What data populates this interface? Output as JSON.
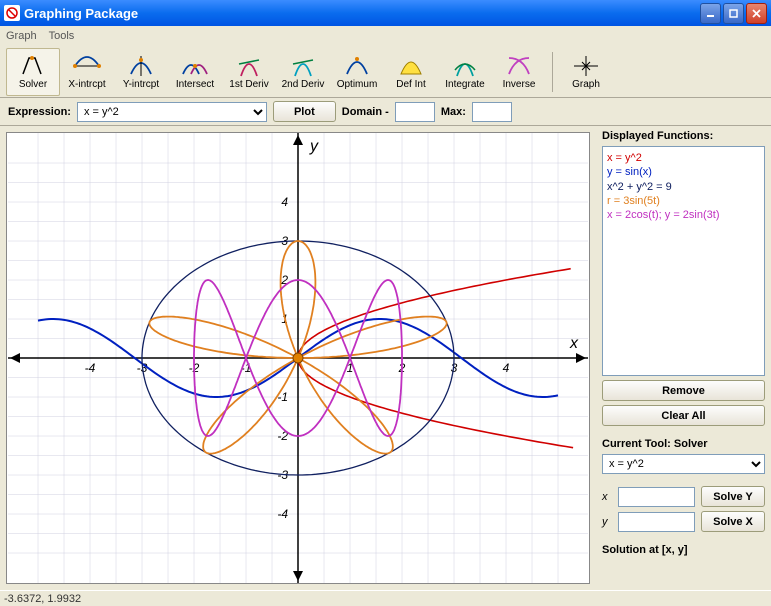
{
  "window": {
    "title": "Graphing Package"
  },
  "menu": {
    "graph": "Graph",
    "tools": "Tools"
  },
  "toolbar": {
    "solver": "Solver",
    "xintrcpt": "X-intrcpt",
    "yintrcpt": "Y-intrcpt",
    "intersect": "Intersect",
    "deriv1": "1st Deriv",
    "deriv2": "2nd Deriv",
    "optimum": "Optimum",
    "defint": "Def Int",
    "integrate": "Integrate",
    "inverse": "Inverse",
    "graph": "Graph"
  },
  "exprbar": {
    "label": "Expression:",
    "value": "x = y^2",
    "plot": "Plot",
    "domain_label": "Domain -",
    "domain_min": "",
    "max_label": "Max:",
    "domain_max": ""
  },
  "chart_data": {
    "type": "line",
    "xlabel": "x",
    "ylabel": "y",
    "xlim": [
      -5,
      5
    ],
    "ylim": [
      -5,
      5
    ],
    "ticks": [
      -4,
      -3,
      -2,
      -1,
      1,
      2,
      3,
      4
    ],
    "series": [
      {
        "name": "x = y^2",
        "color": "#d00000",
        "type": "parametric_parabola"
      },
      {
        "name": "y = sin(x)",
        "color": "#0020c0",
        "type": "sine"
      },
      {
        "name": "x^2 + y^2 = 9",
        "color": "#102060",
        "type": "circle",
        "r": 3
      },
      {
        "name": "r = 3sin(5t)",
        "color": "#e08020",
        "type": "rose",
        "a": 3,
        "k": 5
      },
      {
        "name": "x = 2cos(t); y = 2sin(3t)",
        "color": "#c030c0",
        "type": "lissajous",
        "a": 2,
        "b": 2,
        "p": 1,
        "q": 3
      }
    ]
  },
  "side": {
    "displayed_label": "Displayed Functions:",
    "functions": [
      {
        "text": "x = y^2",
        "color": "#d00000"
      },
      {
        "text": "y = sin(x)",
        "color": "#0020c0"
      },
      {
        "text": "x^2 + y^2 = 9",
        "color": "#102060"
      },
      {
        "text": "r = 3sin(5t)",
        "color": "#e08020"
      },
      {
        "text": "x = 2cos(t); y = 2sin(3t)",
        "color": "#c030c0"
      }
    ],
    "remove": "Remove",
    "clear_all": "Clear All",
    "current_tool_label": "Current Tool: Solver",
    "tool_select": "x = y^2",
    "x_label": "x",
    "y_label": "y",
    "solve_y": "Solve Y",
    "solve_x": "Solve X",
    "x_value": "",
    "y_value": "",
    "solution_label": "Solution at [x, y]"
  },
  "status": {
    "coords": "-3.6372, 1.9932"
  }
}
